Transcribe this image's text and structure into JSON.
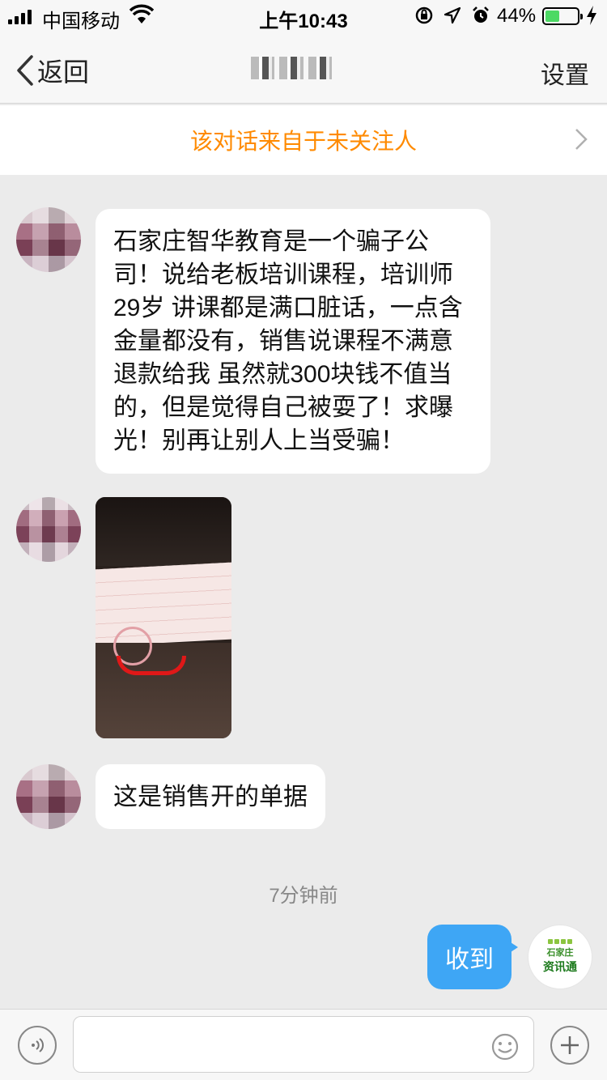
{
  "status_bar": {
    "carrier": "中国移动",
    "time": "上午10:43",
    "battery_percent": "44%",
    "battery_level": 0.44
  },
  "nav": {
    "back_label": "返回",
    "settings_label": "设置"
  },
  "notice": {
    "text": "该对话来自于未关注人"
  },
  "messages": [
    {
      "sender": "incoming",
      "type": "text",
      "text": "石家庄智华教育是一个骗子公司！说给老板培训课程，培训师29岁 讲课都是满口脏话，一点含金量都没有，销售说课程不满意退款给我 虽然就300块钱不值当的，但是觉得自己被耍了！求曝光！别再让别人上当受骗！"
    },
    {
      "sender": "incoming",
      "type": "image"
    },
    {
      "sender": "incoming",
      "type": "text",
      "text": "这是销售开的单据"
    }
  ],
  "timestamp": "7分钟前",
  "outgoing_message": {
    "text": "收到"
  },
  "my_avatar": {
    "line1": "石家庄",
    "line2": "资讯通"
  },
  "input": {
    "placeholder": ""
  },
  "colors": {
    "notice_text": "#ff8a00",
    "outgoing_bubble": "#3ea6f5",
    "battery_fill": "#4cd964"
  }
}
